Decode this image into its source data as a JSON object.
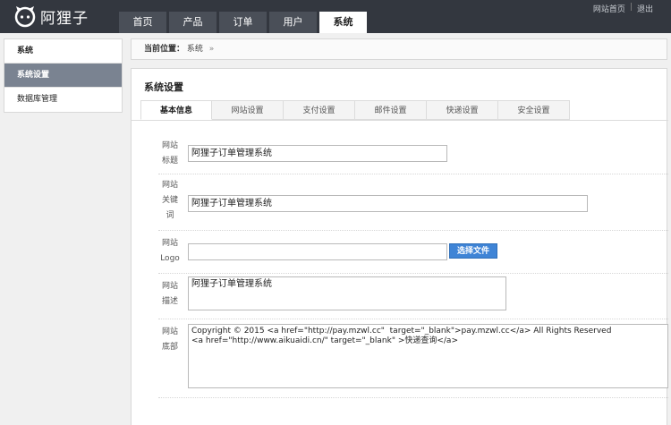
{
  "header": {
    "logo_text": "阿狸子",
    "nav": [
      "首页",
      "产品",
      "订单",
      "用户",
      "系统"
    ],
    "active_nav": "系统",
    "links": {
      "home": "网站首页",
      "sep": "|",
      "logout": "退出"
    }
  },
  "sidebar": {
    "items": [
      {
        "label": "系统"
      },
      {
        "label": "系统设置"
      },
      {
        "label": "数据库管理"
      }
    ]
  },
  "breadcrumb": {
    "label": "当前位置：",
    "current": "系统",
    "arrow": "»"
  },
  "panel": {
    "title": "系统设置",
    "tabs": [
      "基本信息",
      "网站设置",
      "支付设置",
      "邮件设置",
      "快递设置",
      "安全设置"
    ]
  },
  "form": {
    "site_title": {
      "label": [
        "网站",
        "标题"
      ],
      "value": "阿狸子订单管理系统"
    },
    "keywords": {
      "label": [
        "网站",
        "关键",
        "词"
      ],
      "value": "阿狸子订单管理系统"
    },
    "logo": {
      "label": [
        "网站",
        "Logo"
      ],
      "value": "",
      "button": "选择文件"
    },
    "description": {
      "label": [
        "网站",
        "描述"
      ],
      "value": "阿狸子订单管理系统"
    },
    "footer": {
      "label": [
        "网站",
        "底部"
      ],
      "value": "Copyright © 2015 <a href=\"http://pay.mzwl.cc\"  target=\"_blank\">pay.mzwl.cc</a> All Rights Reserved\n<a href=\"http://www.aikuaidi.cn/\" target=\"_blank\" >快递查询</a>"
    }
  }
}
